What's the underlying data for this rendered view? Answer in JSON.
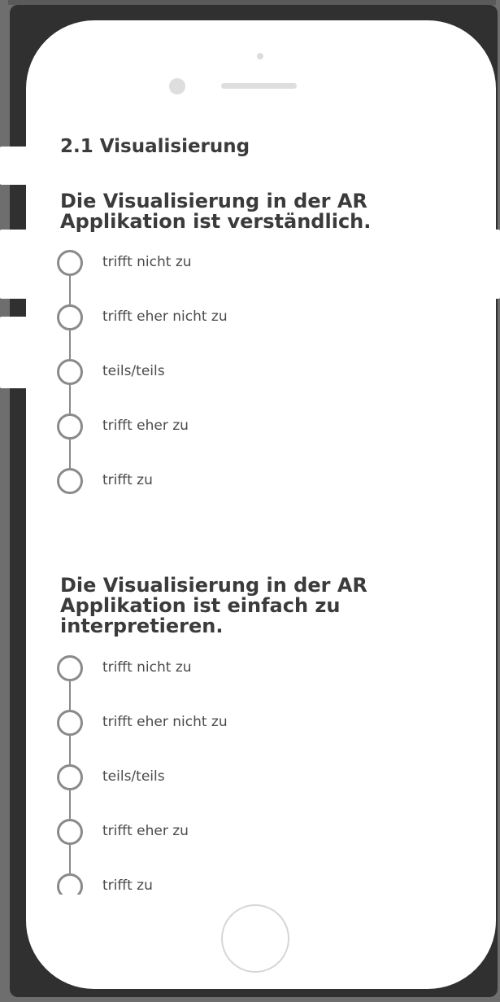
{
  "section": {
    "title": "2.1 Visualisierung"
  },
  "questions": [
    {
      "text": "Die Visualisierung in der AR Applikation ist verständlich.",
      "options": [
        {
          "label": "trifft nicht zu"
        },
        {
          "label": "trifft eher nicht zu"
        },
        {
          "label": "teils/teils"
        },
        {
          "label": "trifft eher zu"
        },
        {
          "label": "trifft zu"
        }
      ]
    },
    {
      "text": "Die Visualisierung in der AR Applikation ist einfach zu interpretieren.",
      "options": [
        {
          "label": "trifft nicht zu"
        },
        {
          "label": "trifft eher nicht zu"
        },
        {
          "label": "teils/teils"
        },
        {
          "label": "trifft eher zu"
        },
        {
          "label": "trifft zu"
        }
      ]
    }
  ],
  "colors": {
    "frame": "#303030",
    "background": "#6e6e6e",
    "text": "#3b3b3b",
    "radio_border": "#8a8a8a"
  }
}
